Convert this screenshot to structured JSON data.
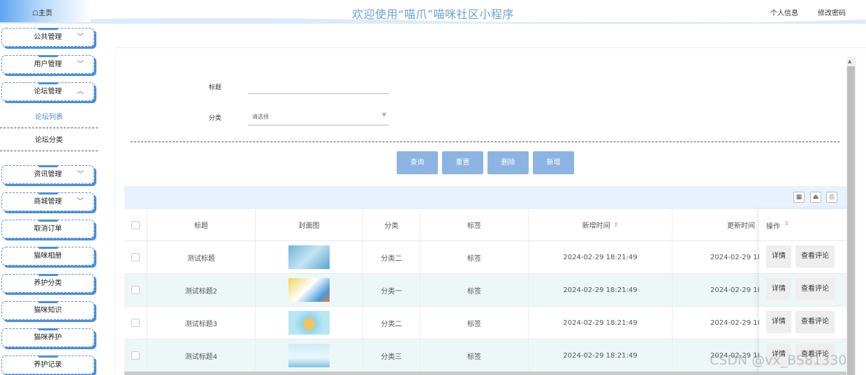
{
  "header": {
    "home_label": "☖主页",
    "title": "欢迎使用“喵爪”喵咪社区小程序",
    "profile_link": "个人信息",
    "password_link": "修改密码"
  },
  "sidebar": {
    "items": [
      {
        "label": "公共管理",
        "chevron": "﹀"
      },
      {
        "label": "用户管理",
        "chevron": "﹀"
      },
      {
        "label": "论坛管理",
        "chevron": "︿"
      },
      {
        "label": "资讯管理",
        "chevron": "﹀"
      },
      {
        "label": "商城管理",
        "chevron": "﹀"
      },
      {
        "label": "取消订单"
      },
      {
        "label": "猫咪相册"
      },
      {
        "label": "养护分类"
      },
      {
        "label": "猫咪知识"
      },
      {
        "label": "猫咪养护"
      },
      {
        "label": "养护记录"
      }
    ],
    "sub_items": [
      {
        "label": "论坛列表",
        "active": true
      },
      {
        "label": "论坛分类",
        "active": false
      }
    ]
  },
  "search": {
    "title_label": "标题",
    "title_value": "",
    "category_label": "分类",
    "category_placeholder": "请选择"
  },
  "actions": {
    "query": "查询",
    "reset": "重置",
    "delete": "删除",
    "add": "新增"
  },
  "toolbar": {
    "icons": [
      "columns-icon",
      "export-icon",
      "print-icon"
    ]
  },
  "table": {
    "columns": [
      "标题",
      "封面图",
      "分类",
      "标签",
      "新增时间",
      "更新时间",
      "操作"
    ],
    "rows": [
      {
        "title": "测试标题",
        "category": "分类二",
        "tag": "标签",
        "created": "2024-02-29 18:21:49",
        "updated": "2024-02-29 18:"
      },
      {
        "title": "测试标题2",
        "category": "分类一",
        "tag": "标签",
        "created": "2024-02-29 18:21:49",
        "updated": "2024-02-29 18:"
      },
      {
        "title": "测试标题3",
        "category": "分类二",
        "tag": "标签",
        "created": "2024-02-29 18:21:49",
        "updated": "2024-02-29 18:"
      },
      {
        "title": "测试标题4",
        "category": "分类三",
        "tag": "标签",
        "created": "2024-02-29 18:21:49",
        "updated": "2024-02-29 18:"
      }
    ],
    "op_detail": "详情",
    "op_comments": "查看评论"
  },
  "watermark": "CSDN @vx_BS81330",
  "colors": {
    "accent": "#4a8fe0",
    "button": "#8cb4e2",
    "title": "#6ba1d8",
    "row_alt": "#eef7f8"
  }
}
